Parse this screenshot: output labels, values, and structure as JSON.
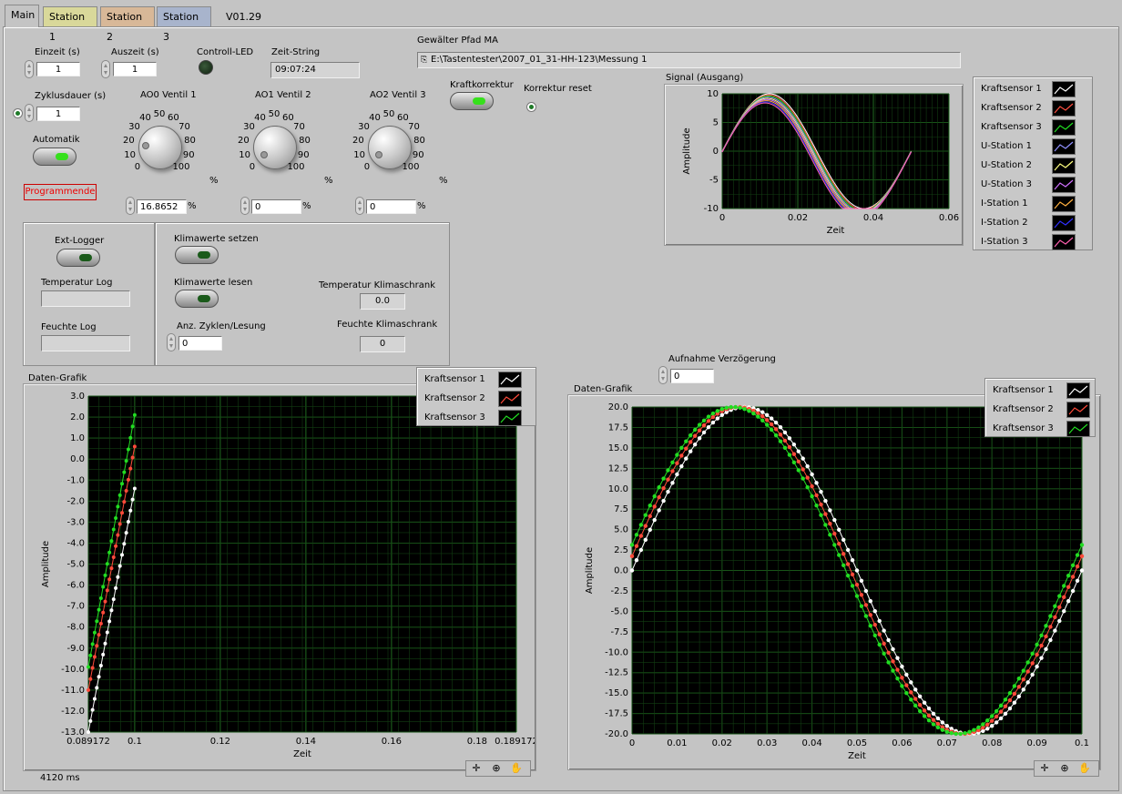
{
  "tabs": [
    {
      "label": "Main",
      "bg": "#c4c4c4"
    },
    {
      "label": "Station 1",
      "bg": "#d9d89a"
    },
    {
      "label": "Station 2",
      "bg": "#d8b898"
    },
    {
      "label": "Station 3",
      "bg": "#a8b4cc"
    }
  ],
  "version": "V01.29",
  "controls": {
    "einzeit": {
      "label": "Einzeit (s)",
      "value": "1"
    },
    "auszeit": {
      "label": "Auszeit (s)",
      "value": "1"
    },
    "controll_led": {
      "label": "Controll-LED"
    },
    "zeit_string": {
      "label": "Zeit-String",
      "value": "09:07:24"
    },
    "zyklusdauer": {
      "label": "Zyklusdauer (s)",
      "value": "1"
    },
    "automatik": {
      "label": "Automatik"
    },
    "programmende": {
      "label": "Programmende"
    },
    "pfad": {
      "label": "Gewälter Pfad MA",
      "value": "E:\\Tastentester\\2007_01_31-HH-123\\Messung  1"
    },
    "kraftkorrektur": {
      "label": "Kraftkorrektur"
    },
    "korrektur_reset": {
      "label": "Korrektur reset"
    }
  },
  "dials": [
    {
      "label": "AO0 Ventil 1",
      "value": "16.8652",
      "unit": "%",
      "level": 16.8652
    },
    {
      "label": "AO1 Ventil 2",
      "value": "0",
      "unit": "%",
      "level": 0
    },
    {
      "label": "AO2 Ventil 3",
      "value": "0",
      "unit": "%",
      "level": 0
    }
  ],
  "dial_ticks": [
    "0",
    "10",
    "20",
    "30",
    "40",
    "50",
    "60",
    "70",
    "80",
    "90",
    "100"
  ],
  "logger": {
    "ext_logger": "Ext-Logger",
    "temperatur_log": "Temperatur Log",
    "feuchte_log": "Feuchte Log"
  },
  "klima": {
    "setzen": "Klimawerte setzen",
    "lesen": "Klimawerte lesen",
    "zyklen_label": "Anz. Zyklen/Lesung",
    "zyklen_value": "0",
    "temp_label": "Temperatur Klimaschrank",
    "temp_value": "0.0",
    "feuchte_label": "Feuchte Klimaschrank",
    "feuchte_value": "0"
  },
  "aufnahme": {
    "label": "Aufnahme Verzögerung",
    "value": "0"
  },
  "status_ms": "4120 ms",
  "signal_legend": [
    {
      "name": "Kraftsensor 1",
      "color": "#ffffff"
    },
    {
      "name": "Kraftsensor 2",
      "color": "#ff5040"
    },
    {
      "name": "Kraftsensor 3",
      "color": "#22dd22"
    },
    {
      "name": "U-Station 1",
      "color": "#9090ff"
    },
    {
      "name": "U-Station 2",
      "color": "#ffff80"
    },
    {
      "name": "U-Station 3",
      "color": "#d070ff"
    },
    {
      "name": "I-Station 1",
      "color": "#ffb040"
    },
    {
      "name": "I-Station 2",
      "color": "#3030ff"
    },
    {
      "name": "I-Station 3",
      "color": "#ff60b0"
    }
  ],
  "chart_data": [
    {
      "type": "line",
      "title": "Signal (Ausgang)",
      "xlabel": "Zeit",
      "ylabel": "Amplitude",
      "xlim": [
        0,
        0.06
      ],
      "ylim": [
        -10,
        10
      ],
      "xticks": [
        "0",
        "0.02",
        "0.04",
        "0.06"
      ],
      "yticks": [
        "10",
        "5",
        "0",
        "-5",
        "-10"
      ],
      "grid": true,
      "series_form": {
        "amplitude": 10,
        "frequency": 20,
        "x_start": 0,
        "x_end": 0.05,
        "phase_offsets": [
          0,
          0.3,
          0.6,
          0.9,
          1.2,
          1.5,
          1.8,
          2.1,
          2.4
        ]
      }
    },
    {
      "type": "line",
      "title": "Daten-Grafik",
      "xlabel": "Zeit",
      "ylabel": "Amplitude",
      "xlim": [
        0.089172,
        0.189172
      ],
      "ylim": [
        -13,
        3
      ],
      "xticks": [
        "0.089172",
        "0.1",
        "0.12",
        "0.14",
        "0.16",
        "0.18",
        "0.189172"
      ],
      "yticks": [
        "3.0",
        "2.0",
        "1.0",
        "0.0",
        "-1.0",
        "-2.0",
        "-3.0",
        "-4.0",
        "-5.0",
        "-6.0",
        "-7.0",
        "-8.0",
        "-9.0",
        "-10.0",
        "-11.0",
        "-12.0",
        "-13.0"
      ],
      "grid": true,
      "legend": "top-right",
      "series": [
        {
          "name": "Kraftsensor 1",
          "color": "#ffffff",
          "x": [
            0.089172,
            0.1
          ],
          "y": [
            -13,
            -1.4
          ]
        },
        {
          "name": "Kraftsensor 2",
          "color": "#ff4a3a",
          "x": [
            0.089172,
            0.1
          ],
          "y": [
            -11,
            0.6
          ]
        },
        {
          "name": "Kraftsensor 3",
          "color": "#22dd22",
          "x": [
            0.089172,
            0.1
          ],
          "y": [
            -9.9,
            2.1
          ]
        }
      ]
    },
    {
      "type": "line",
      "title": "Daten-Grafik",
      "xlabel": "Zeit",
      "ylabel": "Amplitude",
      "xlim": [
        0,
        0.1
      ],
      "ylim": [
        -20,
        20
      ],
      "xticks": [
        "0",
        "0.01",
        "0.02",
        "0.03",
        "0.04",
        "0.05",
        "0.06",
        "0.07",
        "0.08",
        "0.09",
        "0.1"
      ],
      "yticks": [
        "20.0",
        "17.5",
        "15.0",
        "12.5",
        "10.0",
        "7.5",
        "5.0",
        "2.5",
        "0.0",
        "-2.5",
        "-5.0",
        "-7.5",
        "-10.0",
        "-12.5",
        "-15.0",
        "-17.5",
        "-20.0"
      ],
      "grid": true,
      "legend": "top-right",
      "series": [
        {
          "name": "Kraftsensor 1",
          "color": "#ffffff",
          "amplitude": 20,
          "period": 0.1,
          "phase_deg": 0
        },
        {
          "name": "Kraftsensor 2",
          "color": "#ff4a3a",
          "amplitude": 20,
          "period": 0.1,
          "phase_deg": 5
        },
        {
          "name": "Kraftsensor 3",
          "color": "#22dd22",
          "amplitude": 20,
          "period": 0.1,
          "phase_deg": 9
        }
      ]
    }
  ]
}
